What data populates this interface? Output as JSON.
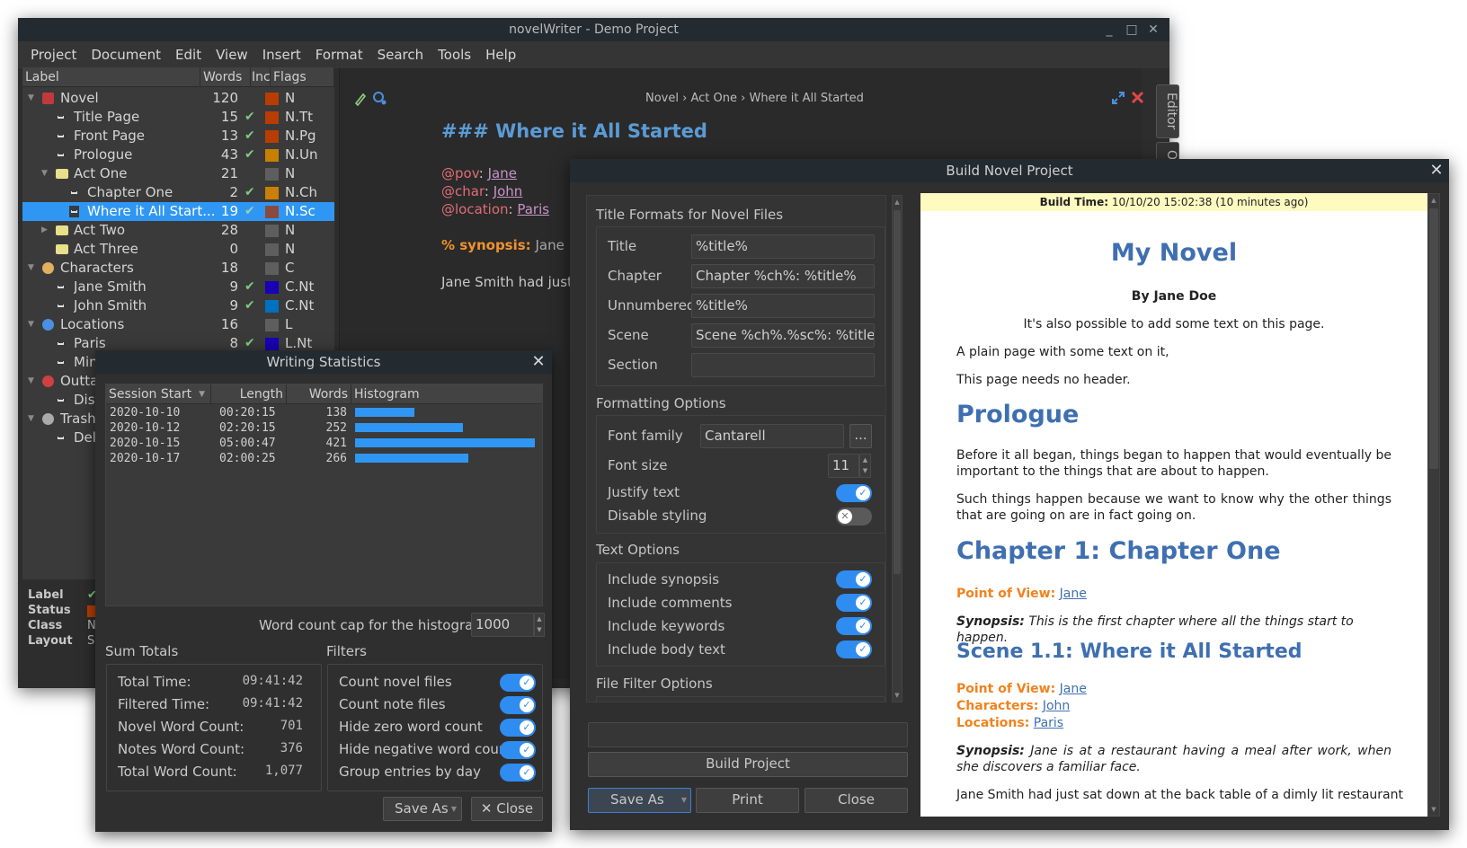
{
  "main_window": {
    "title": "novelWriter - Demo Project",
    "controls": {
      "minimize": "_",
      "maximize": "□",
      "close": "✕"
    },
    "menu": [
      "Project",
      "Document",
      "Edit",
      "View",
      "Insert",
      "Format",
      "Search",
      "Tools",
      "Help"
    ],
    "tree": {
      "headers": {
        "label": "Label",
        "words": "Words",
        "inc": "Inc",
        "flags": "Flags"
      },
      "rows": [
        {
          "label": "Novel",
          "words": "120",
          "inc": "",
          "flag": "N",
          "color": "#b93d00",
          "icon": "novel-root-icon",
          "level": 0,
          "expanded": true
        },
        {
          "label": "Title Page",
          "words": "15",
          "inc": "✔",
          "flag": "N.Tt",
          "color": "#b93d00",
          "icon": "document-icon",
          "level": 1
        },
        {
          "label": "Front Page",
          "words": "13",
          "inc": "✔",
          "flag": "N.Pg",
          "color": "#b93d00",
          "icon": "document-icon",
          "level": 1
        },
        {
          "label": "Prologue",
          "words": "43",
          "inc": "✔",
          "flag": "N.Un",
          "color": "#c98000",
          "icon": "document-icon",
          "level": 1
        },
        {
          "label": "Act One",
          "words": "21",
          "inc": "",
          "flag": "N",
          "color": "#5e5e5e",
          "icon": "folder-icon",
          "level": 1,
          "expanded": true
        },
        {
          "label": "Chapter One",
          "words": "2",
          "inc": "✔",
          "flag": "N.Ch",
          "color": "#c98000",
          "icon": "document-icon",
          "level": 2
        },
        {
          "label": "Where it All Start...",
          "words": "19",
          "inc": "✔",
          "flag": "N.Sc",
          "color": "#8a4a3e",
          "icon": "document-icon",
          "level": 2,
          "selected": true
        },
        {
          "label": "Act Two",
          "words": "28",
          "inc": "",
          "flag": "N",
          "color": "#5e5e5e",
          "icon": "folder-icon",
          "level": 1,
          "collapsed": true
        },
        {
          "label": "Act Three",
          "words": "0",
          "inc": "",
          "flag": "N",
          "color": "#5e5e5e",
          "icon": "folder-icon",
          "level": 1
        },
        {
          "label": "Characters",
          "words": "18",
          "inc": "",
          "flag": "C",
          "color": "#5e5e5e",
          "icon": "character-root-icon",
          "level": 0,
          "expanded": true
        },
        {
          "label": "Jane Smith",
          "words": "9",
          "inc": "✔",
          "flag": "C.Nt",
          "color": "#1a00b4",
          "icon": "document-icon",
          "level": 1
        },
        {
          "label": "John Smith",
          "words": "9",
          "inc": "✔",
          "flag": "C.Nt",
          "color": "#0070c0",
          "icon": "document-icon",
          "level": 1
        },
        {
          "label": "Locations",
          "words": "16",
          "inc": "",
          "flag": "L",
          "color": "#5e5e5e",
          "icon": "location-root-icon",
          "level": 0,
          "expanded": true
        },
        {
          "label": "Paris",
          "words": "8",
          "inc": "✔",
          "flag": "L.Nt",
          "color": "#1a00b4",
          "icon": "document-icon",
          "level": 1
        },
        {
          "label": "Mins",
          "words": "",
          "inc": "",
          "flag": "",
          "color": "",
          "icon": "document-icon",
          "level": 1
        },
        {
          "label": "Outtak",
          "words": "",
          "inc": "",
          "flag": "",
          "color": "",
          "icon": "outtakes-root-icon",
          "level": 0,
          "expanded": true
        },
        {
          "label": "Disc",
          "words": "",
          "inc": "",
          "flag": "",
          "color": "",
          "icon": "document-icon",
          "level": 1
        },
        {
          "label": "Trash",
          "words": "",
          "inc": "",
          "flag": "",
          "color": "",
          "icon": "trash-root-icon",
          "level": 0,
          "expanded": true
        },
        {
          "label": "Dele",
          "words": "",
          "inc": "",
          "flag": "",
          "color": "",
          "icon": "document-icon",
          "level": 1
        }
      ]
    },
    "details": {
      "label_key": "Label",
      "label_val": "✔",
      "status_key": "Status",
      "status_color": "#b93d00",
      "class_key": "Class",
      "class_val": "N",
      "layout_key": "Layout",
      "layout_val": "Sc"
    },
    "editor": {
      "breadcrumb": [
        "Novel",
        "›",
        "Act One",
        "›",
        "Where it All Started"
      ],
      "heading": "### Where it All Started",
      "keywords": [
        {
          "key": "@pov",
          "value": "Jane"
        },
        {
          "key": "@char",
          "value": "John"
        },
        {
          "key": "@location",
          "value": "Paris"
        }
      ],
      "synopsis_key": "% synopsis:",
      "synopsis_text": " Jane is at a",
      "body": "Jane Smith had just sat",
      "tabs": [
        "Editor",
        "Out"
      ]
    }
  },
  "writing_stats": {
    "title": "Writing Statistics",
    "headers": {
      "session": "Session Start",
      "length": "Length",
      "words": "Words",
      "histogram": "Histogram"
    },
    "rows": [
      {
        "date": "2020-10-10",
        "length": "00:20:15",
        "words": "138",
        "fraction": 0.328
      },
      {
        "date": "2020-10-12",
        "length": "02:20:15",
        "words": "252",
        "fraction": 0.599
      },
      {
        "date": "2020-10-15",
        "length": "05:00:47",
        "words": "421",
        "fraction": 1.0
      },
      {
        "date": "2020-10-17",
        "length": "02:00:25",
        "words": "266",
        "fraction": 0.632
      }
    ],
    "cap_label": "Word count cap for the histogram",
    "cap_value": "1000",
    "sum_totals_label": "Sum Totals",
    "totals": [
      {
        "label": "Total Time:",
        "value": "09:41:42"
      },
      {
        "label": "Filtered Time:",
        "value": "09:41:42"
      },
      {
        "label": "Novel Word Count:",
        "value": "701"
      },
      {
        "label": "Notes Word Count:",
        "value": "376"
      },
      {
        "label": "Total Word Count:",
        "value": "1,077"
      }
    ],
    "filters_label": "Filters",
    "filters": [
      {
        "label": "Count novel files",
        "on": true
      },
      {
        "label": "Count note files",
        "on": true
      },
      {
        "label": "Hide zero word count",
        "on": true
      },
      {
        "label": "Hide negative word count",
        "on": true
      },
      {
        "label": "Group entries by day",
        "on": true
      }
    ],
    "save_as": "Save As",
    "close": "✕ Close"
  },
  "build": {
    "title": "Build Novel Project",
    "title_formats_label": "Title Formats for Novel Files",
    "title_formats": [
      {
        "label": "Title",
        "value": "%title%"
      },
      {
        "label": "Chapter",
        "value": "Chapter %ch%: %title%"
      },
      {
        "label": "Unnumbered",
        "value": "%title%"
      },
      {
        "label": "Scene",
        "value": "Scene %ch%.%sc%: %title%"
      },
      {
        "label": "Section",
        "value": ""
      }
    ],
    "formatting_label": "Formatting Options",
    "font_family_label": "Font family",
    "font_family_value": "Cantarell",
    "font_btn": "...",
    "font_size_label": "Font size",
    "font_size_value": "11",
    "justify_label": "Justify text",
    "justify_on": true,
    "disable_styling_label": "Disable styling",
    "disable_styling_on": false,
    "text_options_label": "Text Options",
    "text_options": [
      {
        "label": "Include synopsis",
        "on": true
      },
      {
        "label": "Include comments",
        "on": true
      },
      {
        "label": "Include keywords",
        "on": true
      },
      {
        "label": "Include body text",
        "on": true
      }
    ],
    "file_filter_label": "File Filter Options",
    "build_btn": "Build Project",
    "save_as": "Save As",
    "print": "Print",
    "close": "Close",
    "preview": {
      "build_time_key": "Build Time:",
      "build_time_value": " 10/10/20 15:02:38 (10 minutes ago)",
      "title": "My Novel",
      "author": "By Jane Doe",
      "front_text": "It's also possible to add some text on this page.",
      "plain1": "A plain page with some text on it,",
      "plain2": "This page needs no header.",
      "prologue": "Prologue",
      "prologue_p1": "Before it all began, things began to happen that would eventually be important to the things that are about to happen.",
      "prologue_p2": "Such things happen because we want to know why the other things that are going on are in fact going on.",
      "chapter": "Chapter 1: Chapter One",
      "pov_key": "Point of View:",
      "pov_val": "Jane",
      "synopsis_key": "Synopsis:",
      "chapter_synopsis": " This is the first chapter where all the things start to happen.",
      "scene": "Scene 1.1: Where it All Started",
      "chars_key": "Characters:",
      "chars_val": "John",
      "locs_key": "Locations:",
      "locs_val": "Paris",
      "scene_synopsis": " Jane is at a restaurant having a meal after work, when she discovers a familiar face.",
      "body": "Jane Smith had just sat down at the back table of a dimly lit restaurant"
    }
  }
}
